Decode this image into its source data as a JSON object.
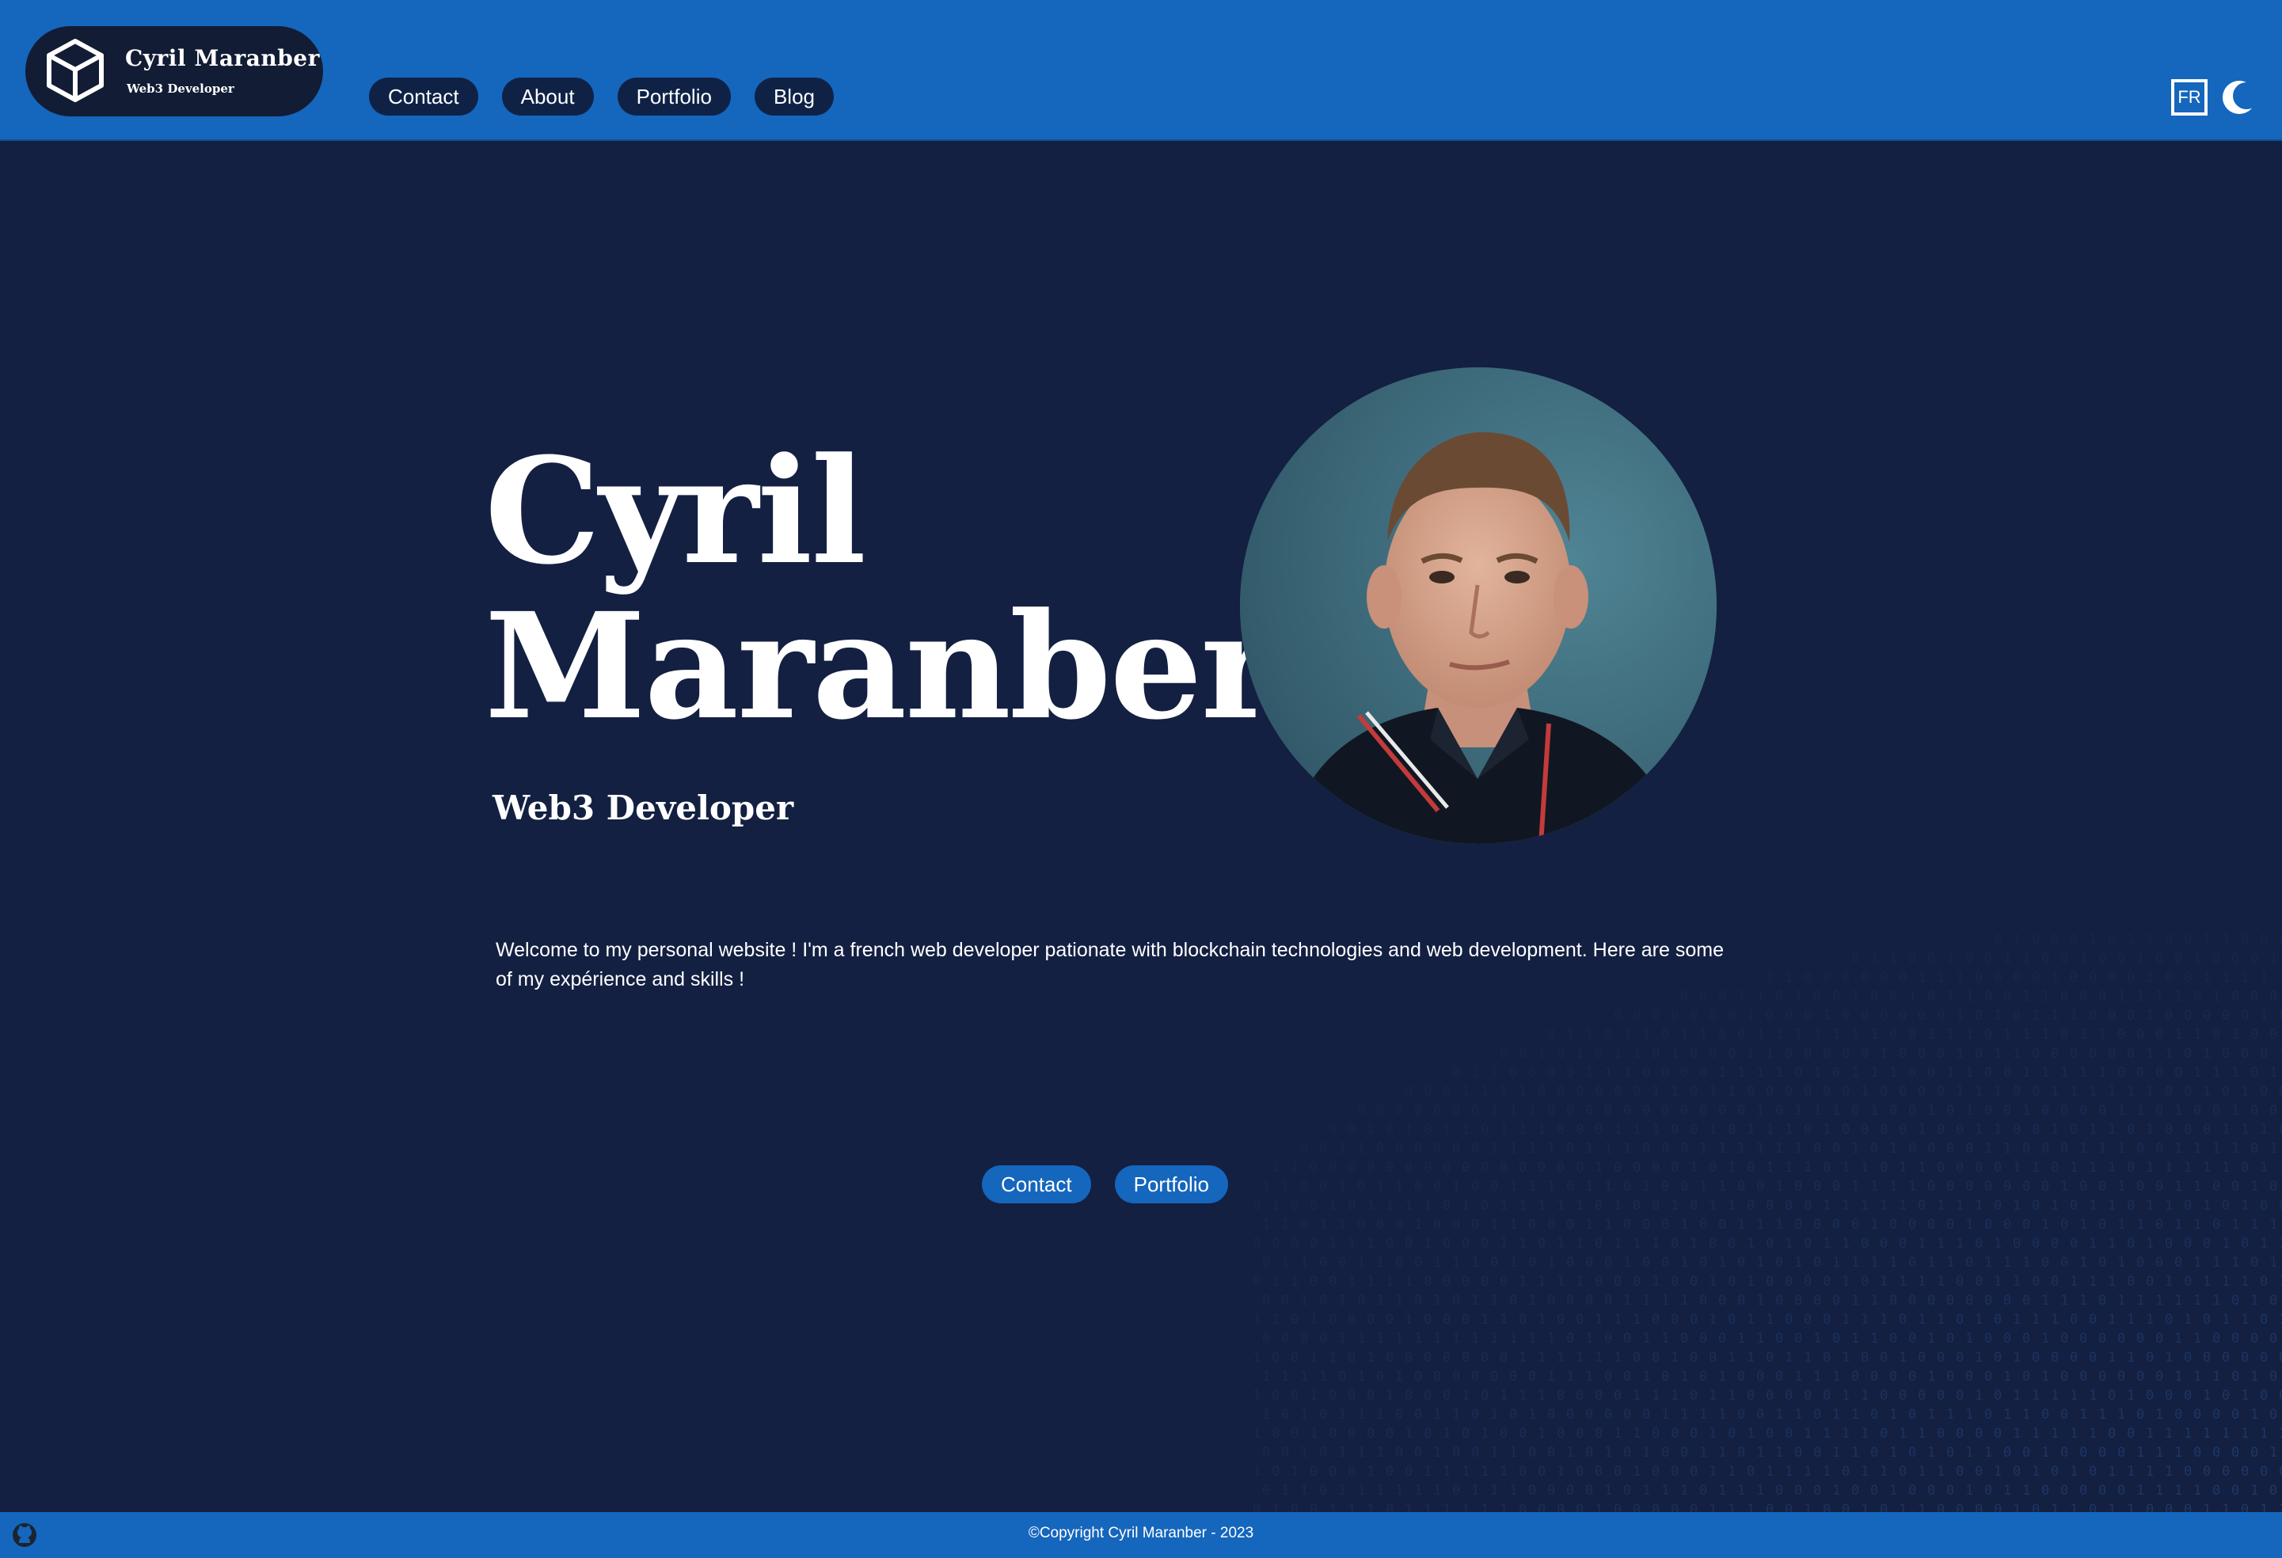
{
  "colors": {
    "header_bg": "#1566bd",
    "page_bg": "#132042",
    "nav_pill_bg": "#0f2246",
    "cta_bg": "#1566bd",
    "text": "#ffffff"
  },
  "brand": {
    "name": "Cyril Maranber",
    "subtitle": "Web3 Developer",
    "logo_icon": "cube-icon"
  },
  "nav": {
    "items": [
      {
        "label": "Contact"
      },
      {
        "label": "About"
      },
      {
        "label": "Portfolio"
      },
      {
        "label": "Blog"
      }
    ]
  },
  "header_tools": {
    "language_label": "FR",
    "theme_icon": "moon-icon"
  },
  "hero": {
    "name_line1": "Cyril",
    "name_line2": "Maranber",
    "subtitle": "Web3 Developer",
    "photo_icon": "profile-photo",
    "intro": "Welcome to my personal website ! I'm a french web developer pationate with blockchain technologies and web development. Here are some of my expérience and skills !"
  },
  "cta": {
    "contact_label": "Contact",
    "portfolio_label": "Portfolio"
  },
  "footer": {
    "copyright": "©Copyright Cyril Maranber - 2023",
    "github_icon": "github-icon"
  }
}
